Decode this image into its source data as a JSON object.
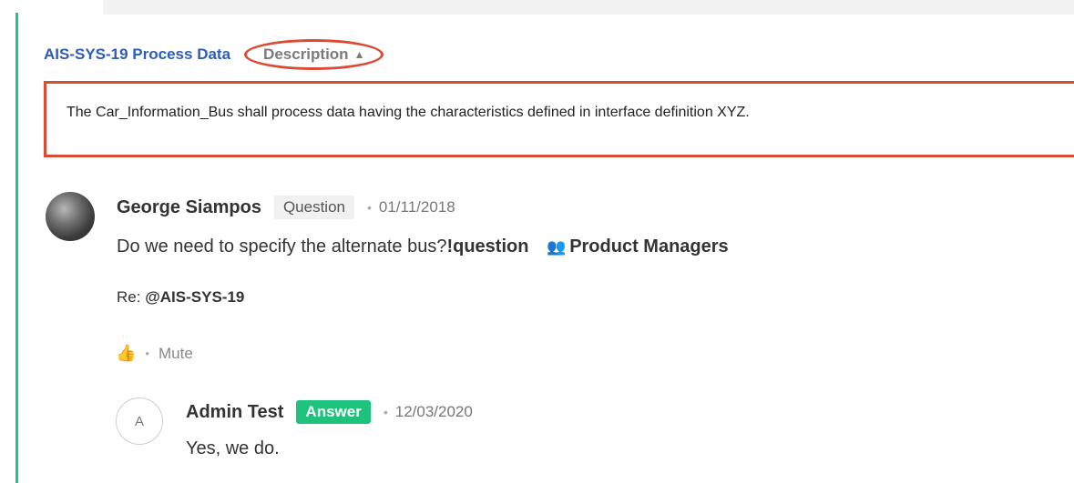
{
  "requirement": {
    "link_text": "AIS-SYS-19 Process Data",
    "description_toggle": "Description",
    "description_text": "The Car_Information_Bus shall process data having the characteristics defined in interface definition XYZ."
  },
  "comment": {
    "author": "George Siampos",
    "type_tag": "Question",
    "date": "01/11/2018",
    "body_text": "Do we need to specify the alternate bus?",
    "hashtag": "!question",
    "group": "Product Managers",
    "re_label": "Re:",
    "re_mention": "@AIS-SYS-19",
    "mute_label": "Mute"
  },
  "reply": {
    "avatar_initial": "A",
    "author": "Admin Test",
    "type_tag": "Answer",
    "date": "12/03/2020",
    "body_text": "Yes, we do."
  },
  "colors": {
    "accent_green": "#22c58b",
    "answer_green": "#1fc27d",
    "link_blue": "#2d5db8",
    "highlight_red": "#d94b33"
  },
  "icons": {
    "collapse": "chevron-up-icon",
    "group": "group-icon",
    "like": "thumbs-up-icon"
  }
}
